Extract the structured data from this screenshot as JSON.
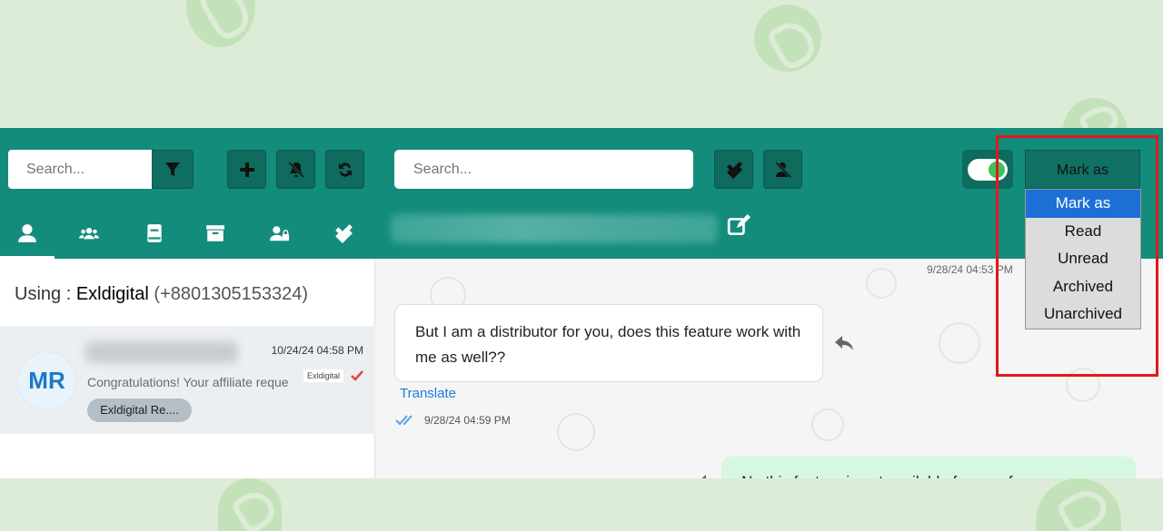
{
  "colors": {
    "topbar": "#138c7c",
    "button_dark": "#0e6b5e",
    "dropdown_selected": "#1d6fd6",
    "highlight": "#e31818",
    "outgoing_bubble": "#d6f8e2",
    "avatar_text": "#1e78c8"
  },
  "left_toolbar": {
    "search_placeholder": "Search...",
    "buttons": [
      "filter-icon",
      "plus-icon",
      "bell-slash-icon",
      "sync-icon"
    ]
  },
  "left_tabs": [
    "user-icon",
    "users-icon",
    "book-icon",
    "archive-icon",
    "user-lock-icon",
    "double-check-icon"
  ],
  "chat_toolbar": {
    "search_placeholder": "Search...",
    "buttons": [
      "double-check-icon",
      "user-slash-icon"
    ],
    "edit_icon": "edit-icon"
  },
  "mark_as": {
    "button_label": "Mark as",
    "options": [
      "Mark as",
      "Read",
      "Unread",
      "Archived",
      "Unarchived"
    ],
    "selected": "Mark as"
  },
  "account": {
    "prefix": "Using :",
    "name": "Exldigital",
    "phone": "(+8801305153324)"
  },
  "chat_list": [
    {
      "avatar": "MR",
      "time": "10/24/24 04:58 PM",
      "preview": "Congratulations! Your affiliate reque",
      "account_badge": "Exldigital",
      "tag": "Exldigital Re...."
    }
  ],
  "messages": {
    "top_timestamp": "9/28/24 04:53 PM",
    "incoming_text": "But I am a distributor for you, does this feature work with me as well??",
    "translate_label": "Translate",
    "incoming_time": "9/28/24 04:59 PM",
    "outgoing_text": "No this feature is not available for you, for"
  }
}
